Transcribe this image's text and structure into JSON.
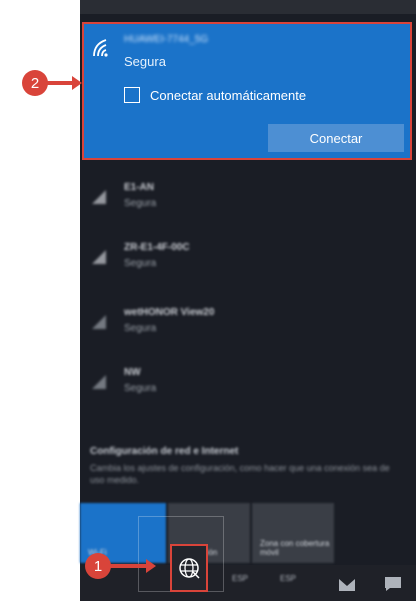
{
  "selected_network": {
    "ssid": "HUAWEI-7744_5G",
    "status": "Segura",
    "auto_connect_label": "Conectar automáticamente",
    "connect_label": "Conectar"
  },
  "networks": [
    {
      "name": "E1-AN",
      "status": "Segura"
    },
    {
      "name": "ZR-E1-4F-00C",
      "status": "Segura"
    },
    {
      "name": "wetHONOR View20",
      "status": "Segura"
    },
    {
      "name": "NW",
      "status": "Segura"
    }
  ],
  "settings": {
    "title": "Configuración de red e Internet",
    "description": "Cambia los ajustes de configuración, como hacer que una conexión sea de uso medido."
  },
  "quick_actions": [
    "Wi-Fi",
    "Modo avión",
    "Zona con cobertura móvil"
  ],
  "taskbar": {
    "items": [
      "ESP",
      "ESP",
      "Notificaciones"
    ]
  },
  "callouts": {
    "one": "1",
    "two": "2"
  },
  "colors": {
    "accent": "#1b73c9",
    "callout": "#d9443a",
    "panel": "#1a1d25"
  }
}
